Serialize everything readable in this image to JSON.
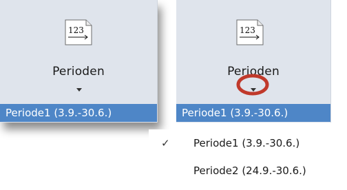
{
  "left_panel": {
    "icon": "number-sequence-icon",
    "icon_text": "123",
    "label": "Perioden",
    "selected_value": "Periode1 (3.9.-30.6.)"
  },
  "right_panel": {
    "icon": "number-sequence-icon",
    "icon_text": "123",
    "label": "Perioden",
    "selected_value": "Periode1 (3.9.-30.6.)",
    "annotation": "red-circle-highlight"
  },
  "menu": {
    "items": [
      {
        "label": "Periode1 (3.9.-30.6.)",
        "checked": true,
        "check_glyph": "✓"
      },
      {
        "label": "Periode2 (24.9.-30.6.)",
        "checked": false,
        "check_glyph": ""
      }
    ]
  },
  "colors": {
    "panel_bg": "#dfe4ec",
    "selection_bg": "#4e86c7",
    "annotation": "#c0392b"
  }
}
